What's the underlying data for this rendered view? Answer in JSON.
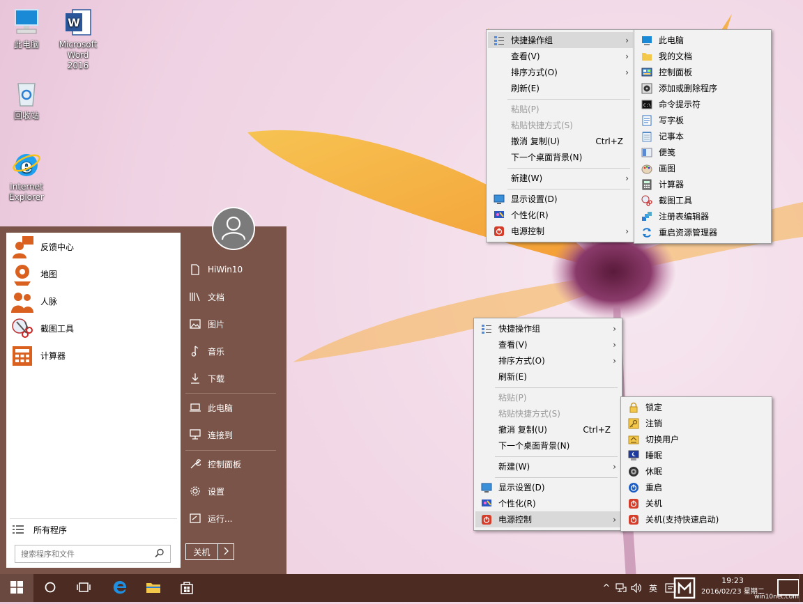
{
  "desktop": {
    "icons": [
      {
        "label": "此电脑"
      },
      {
        "label": "Microsoft Word 2016"
      },
      {
        "label": "回收站"
      },
      {
        "label": "Internet Explorer"
      }
    ]
  },
  "start_menu": {
    "apps": [
      {
        "label": "反馈中心"
      },
      {
        "label": "地图"
      },
      {
        "label": "人脉"
      },
      {
        "label": "截图工具"
      },
      {
        "label": "计算器"
      }
    ],
    "all_programs": "所有程序",
    "search_placeholder": "搜索程序和文件",
    "right_items": [
      {
        "label": "HiWin10"
      },
      {
        "label": "文档"
      },
      {
        "label": "图片"
      },
      {
        "label": "音乐"
      },
      {
        "label": "下载"
      },
      {
        "label": "此电脑"
      },
      {
        "label": "连接到"
      },
      {
        "label": "控制面板"
      },
      {
        "label": "设置"
      },
      {
        "label": "运行..."
      }
    ],
    "shutdown": "关机"
  },
  "menu_top": {
    "items": [
      {
        "label": "快捷操作组"
      },
      {
        "label": "查看(V)"
      },
      {
        "label": "排序方式(O)"
      },
      {
        "label": "刷新(E)"
      },
      {
        "label": "粘贴(P)"
      },
      {
        "label": "粘贴快捷方式(S)"
      },
      {
        "label": "撤消 复制(U)",
        "shortcut": "Ctrl+Z"
      },
      {
        "label": "下一个桌面背景(N)"
      },
      {
        "label": "新建(W)"
      },
      {
        "label": "显示设置(D)"
      },
      {
        "label": "个性化(R)"
      },
      {
        "label": "电源控制"
      }
    ]
  },
  "submenu_top": {
    "items": [
      {
        "label": "此电脑"
      },
      {
        "label": "我的文档"
      },
      {
        "label": "控制面板"
      },
      {
        "label": "添加或删除程序"
      },
      {
        "label": "命令提示符"
      },
      {
        "label": "写字板"
      },
      {
        "label": "记事本"
      },
      {
        "label": "便笺"
      },
      {
        "label": "画图"
      },
      {
        "label": "计算器"
      },
      {
        "label": "截图工具"
      },
      {
        "label": "注册表编辑器"
      },
      {
        "label": "重启资源管理器"
      }
    ]
  },
  "menu_bottom": {
    "items": [
      {
        "label": "快捷操作组"
      },
      {
        "label": "查看(V)"
      },
      {
        "label": "排序方式(O)"
      },
      {
        "label": "刷新(E)"
      },
      {
        "label": "粘贴(P)"
      },
      {
        "label": "粘贴快捷方式(S)"
      },
      {
        "label": "撤消 复制(U)",
        "shortcut": "Ctrl+Z"
      },
      {
        "label": "下一个桌面背景(N)"
      },
      {
        "label": "新建(W)"
      },
      {
        "label": "显示设置(D)"
      },
      {
        "label": "个性化(R)"
      },
      {
        "label": "电源控制"
      }
    ]
  },
  "power_menu": {
    "items": [
      {
        "label": "锁定"
      },
      {
        "label": "注销"
      },
      {
        "label": "切换用户"
      },
      {
        "label": "睡眠"
      },
      {
        "label": "休眠"
      },
      {
        "label": "重启"
      },
      {
        "label": "关机"
      },
      {
        "label": "关机(支持快速启动)"
      }
    ]
  },
  "taskbar": {
    "ime": "英",
    "time": "19:23",
    "date": "2016/02/23 星期二",
    "watermark": "win10net.com",
    "arrow": "^"
  },
  "colors": {
    "start_bg": "#7a5448",
    "taskbar_bg": "#4c2c22",
    "menu_bg": "#f2f2f2",
    "menu_highlight": "#d9d9d9"
  }
}
